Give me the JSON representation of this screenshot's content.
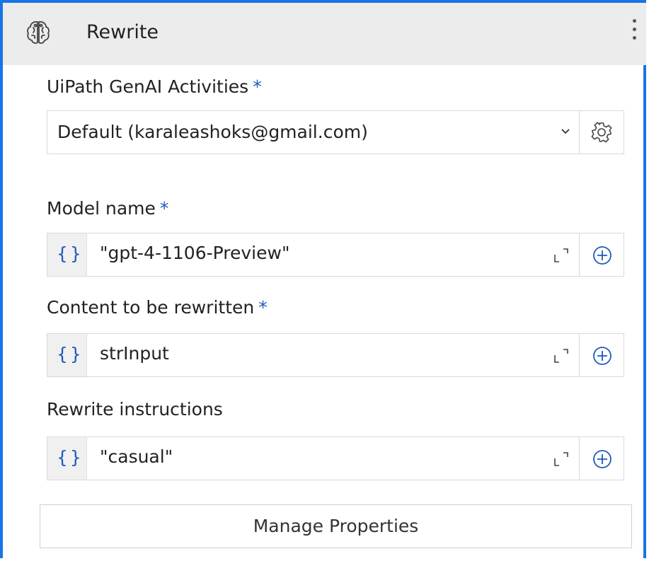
{
  "header": {
    "title": "Rewrite",
    "icon": "brain-icon",
    "menu_icon": "more-vertical-icon"
  },
  "connection": {
    "label": "UiPath GenAI Activities",
    "required_mark": "*",
    "selected_value": "Default (karaleashoks@gmail.com)",
    "dropdown_icon": "chevron-down-icon",
    "settings_icon": "gear-icon"
  },
  "fields": [
    {
      "label": "Model name",
      "required_mark": "*",
      "type_icon": "{}",
      "value": "\"gpt-4-1106-Preview\""
    },
    {
      "label": "Content to be rewritten",
      "required_mark": "*",
      "type_icon": "{}",
      "value": "strInput"
    },
    {
      "label": "Rewrite instructions",
      "required_mark": "",
      "type_icon": "{}",
      "value": "\"casual\""
    }
  ],
  "manage_button": {
    "label": "Manage Properties"
  },
  "colors": {
    "accent_border": "#1a73e8",
    "required_mark": "#1e5bb8",
    "header_bg": "#ececec"
  }
}
